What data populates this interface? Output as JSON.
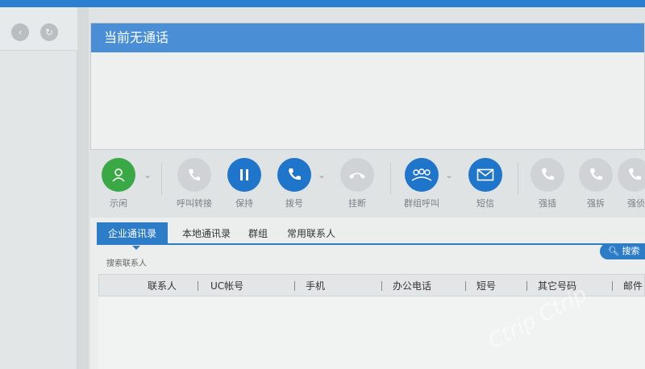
{
  "call_panel": {
    "status": "当前无通话"
  },
  "toolbar": {
    "buttons": [
      {
        "label": "示闲"
      },
      {
        "label": "呼叫转接"
      },
      {
        "label": "保持"
      },
      {
        "label": "拨号"
      },
      {
        "label": "挂断"
      },
      {
        "label": "群组呼叫"
      },
      {
        "label": "短信"
      },
      {
        "label": "强插"
      },
      {
        "label": "强拆"
      },
      {
        "label": "强侦"
      }
    ]
  },
  "contacts": {
    "tabs": [
      "企业通讯录",
      "本地通讯录",
      "群组",
      "常用联系人"
    ],
    "search_placeholder": "搜索联系人",
    "search_button": "搜索",
    "columns": [
      "联系人",
      "UC帐号",
      "手机",
      "办公电话",
      "短号",
      "其它号码",
      "邮件"
    ]
  },
  "watermark": "Ctrip Ctrip",
  "colors": {
    "accent": "#2d7cc8",
    "header": "#4a8fd5",
    "green": "#3aa845"
  }
}
